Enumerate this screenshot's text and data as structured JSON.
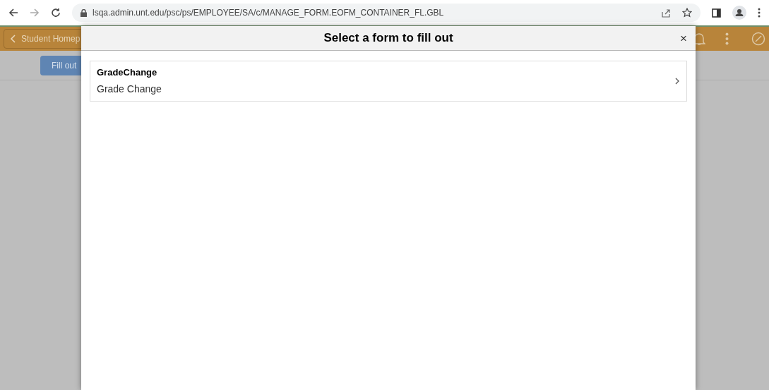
{
  "browser": {
    "url": "lsqa.admin.unt.edu/psc/ps/EMPLOYEE/SA/c/MANAGE_FORM.EOFM_CONTAINER_FL.GBL"
  },
  "app": {
    "back_label": "Student Homep",
    "fill_button": "Fill out"
  },
  "dialog": {
    "title": "Select a form to fill out",
    "close": "×",
    "forms": [
      {
        "name": "GradeChange",
        "description": "Grade Change"
      }
    ]
  }
}
